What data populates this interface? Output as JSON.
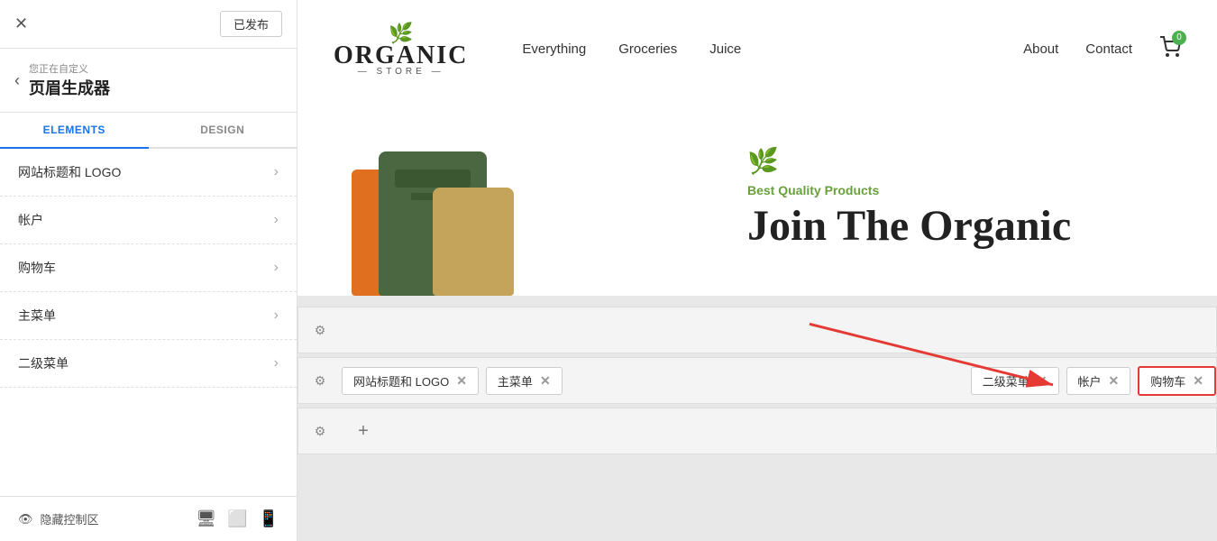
{
  "leftPanel": {
    "closeBtn": "✕",
    "publishedBtn": "已发布",
    "backArrow": "‹",
    "subtitle": "您正在自定义",
    "title": "页眉生成器",
    "tabs": [
      {
        "id": "elements",
        "label": "ELEMENTS",
        "active": true
      },
      {
        "id": "design",
        "label": "DESIGN",
        "active": false
      }
    ],
    "items": [
      {
        "label": "网站标题和 LOGO",
        "arrow": "›"
      },
      {
        "label": "帐户",
        "arrow": "›"
      },
      {
        "label": "购物车",
        "arrow": "›"
      },
      {
        "label": "主菜单",
        "arrow": "›"
      },
      {
        "label": "二级菜单",
        "arrow": "›"
      }
    ],
    "footer": {
      "hideLabel": "隐藏控制区",
      "icons": [
        "🖥",
        "📱",
        "📱"
      ]
    }
  },
  "siteHeader": {
    "logoText": "ORGANIC",
    "logoSub": "STORE",
    "navLinks": [
      "Everything",
      "Groceries",
      "Juice"
    ],
    "navRight": [
      "About",
      "Contact"
    ],
    "cartCount": "0"
  },
  "heroSection": {
    "leafIcon": "🌿",
    "subtitle": "Best Quality Products",
    "title": "Join The Organic"
  },
  "builderRows": [
    {
      "id": "row1",
      "chips": []
    },
    {
      "id": "row2",
      "chips": [
        {
          "label": "网站标题和 LOGO",
          "highlighted": false
        },
        {
          "label": "主菜单",
          "highlighted": false
        },
        {
          "label": "二级菜单",
          "highlighted": false
        },
        {
          "label": "帐户",
          "highlighted": false
        },
        {
          "label": "购物车",
          "highlighted": true
        }
      ]
    },
    {
      "id": "row3",
      "chips": []
    }
  ],
  "icons": {
    "gear": "⚙",
    "close": "✕",
    "plus": "+",
    "back": "‹",
    "desktop": "🖥",
    "eyeOff": "👁",
    "tablet": "⬜",
    "mobile": "📱"
  }
}
